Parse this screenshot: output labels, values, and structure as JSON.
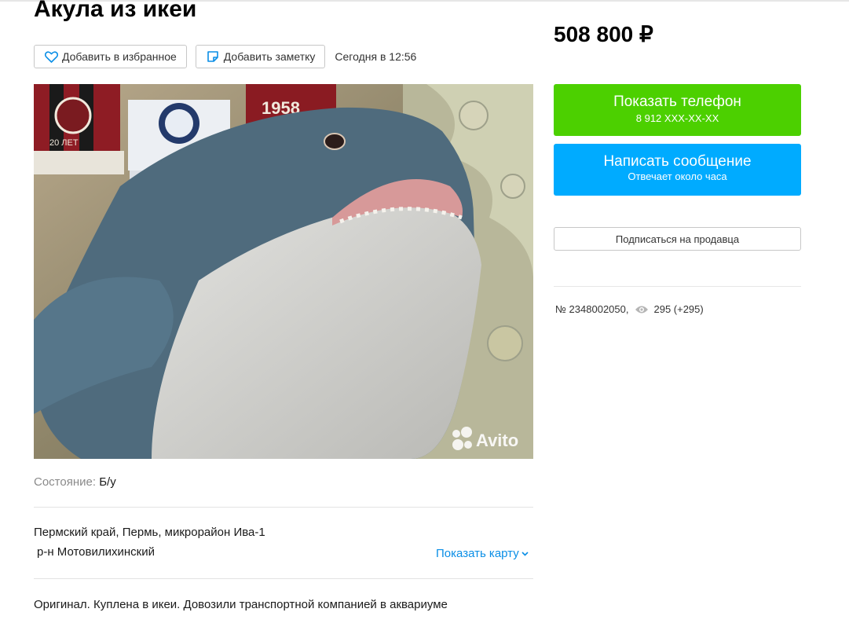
{
  "listing": {
    "title": "Акула из икеи",
    "price": "508 800 ₽",
    "actions": {
      "favorite_label": "Добавить в избранное",
      "note_label": "Добавить заметку",
      "date": "Сегодня в 12:56"
    },
    "photo": {
      "watermark": "Avito",
      "scarf_text_left": "20 ЛЕТ",
      "scarf_text_right": "1958"
    },
    "condition": {
      "label": "Состояние:",
      "value": "Б/у"
    },
    "address": {
      "line1": "Пермский край, Пермь, микрорайон Ива-1",
      "line2": "р-н Мотовилихинский",
      "map_link": "Показать карту"
    },
    "description": "Оригинал. Куплена в икеи. Довозили транспортной компанией в аквариуме"
  },
  "sidebar": {
    "phone_button": {
      "label": "Показать телефон",
      "number": "8 912 XXX-XX-XX"
    },
    "message_button": {
      "label": "Написать сообщение",
      "sub": "Отвечает около часа"
    },
    "subscribe_label": "Подписаться на продавца",
    "ad_number": "№ 2348002050,",
    "views": "295 (+295)"
  },
  "colors": {
    "phone_green": "#4cd000",
    "message_blue": "#00abff",
    "link_blue": "#0a8ee6",
    "heart_icon": "#0a8ee6",
    "note_icon": "#0a8ee6"
  },
  "icons": [
    "heart-icon",
    "note-icon",
    "chevron-down-icon",
    "eye-icon",
    "avito-logo-icon"
  ]
}
